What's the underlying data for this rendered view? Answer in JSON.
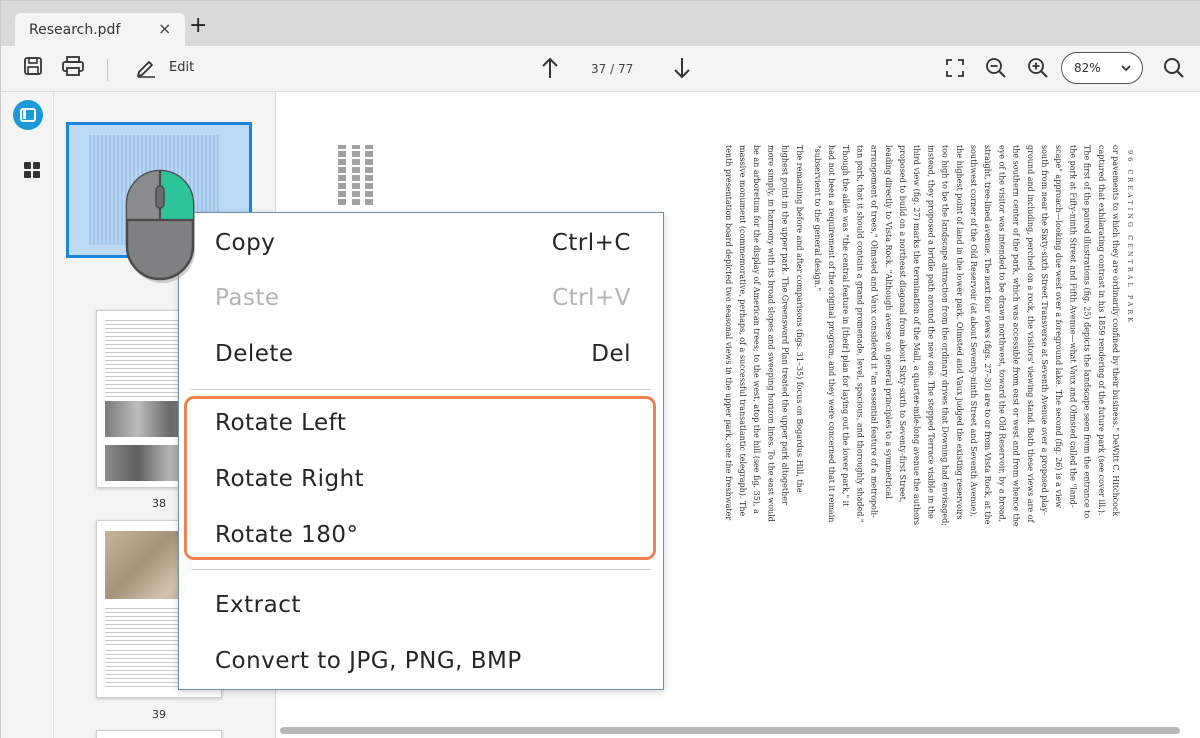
{
  "tab": {
    "title": "Research.pdf",
    "close": "×",
    "new": "+"
  },
  "toolbar": {
    "edit_label": "Edit",
    "page_indicator": "37 / 77",
    "zoom_value": "82%"
  },
  "thumbnails": {
    "page_numbers": [
      "38",
      "39"
    ]
  },
  "document": {
    "running_header": "96   CREATING CENTRAL PARK",
    "column_lines": [
      "or pavements to which they are ordinarily confined by their business.\" DeWitt C. Hitchcock",
      "captured that exhilarating contrast in his 1859 rendering of the future park (see cover ill.).",
      "The first of the paired illustrations (fig. 25) depicts the landscape seen from the entrance to",
      "the park at Fifty-ninth Street and Fifth Avenue—what Vaux and Olmsted called the \"land-",
      "scape\" approach—looking due west over a foreground lake. The second (fig. 26) is a view",
      "south from near the Sixty-sixth Street Transverse at Seventh Avenue over a proposed play-",
      "ground and including, perched on a rock, the visitors' viewing stand. Both these views are of",
      "the southern center of the park, which was accessible from east or west and from whence the",
      "eye of the visitor was intended to be drawn northwest, toward the Old Reservoir, by a broad,",
      "straight, tree-lined avenue. The next four views (figs. 27–30) are to or from Vista Rock, at the",
      "southwest corner of the Old Reservoir (at about Seventy-ninth Street and Seventh Avenue),",
      "the highest point of land in the lower park. Olmsted and Vaux judged the existing reservoirs",
      "too high to be the landscape attraction from the ordinary drives that Downing had envisaged;",
      "instead, they proposed a bridle path around the new one. The stepped Terrace visible in the",
      "third view (fig. 27) marks the termination of the Mall, a quarter-mile-long avenue the authors",
      "proposed to build on a northeast diagonal from about Sixty-sixth to Seventy-first Street,",
      "leading directly to Vista Rock. \"Although averse on general principles to a symmetrical",
      "arrangement of trees,\" Olmsted and Vaux considered it \"an essential feature of a metropoli-",
      "tan park, that it should contain a grand promenade, level, spacious, and thoroughly shaded.\"",
      "Though the allée was \"the central feature in [their] plan for laying out the lower park,\" it",
      "had not been a requirement of the original program, and they were concerned that it remain",
      "\"subservient to the general design.\"",
      "The remaining before and after comparisons (figs. 31–35) focus on Bogardus Hill, the",
      "highest point in the upper park. The Greensward Plan treated the upper park altogether",
      "more simply, in harmony with its broad slopes and sweeping horizon lines. To the east would",
      "be an arboretum for the display of American trees; to the west, atop the hill (see fig. 35), a",
      "massive monument (commemorative, perhaps, of a successful transatlantic telegraph). The",
      "tenth presentation board depicted two seasonal views in the upper park, one the freshwater"
    ]
  },
  "context_menu": {
    "items": [
      {
        "label": "Copy",
        "shortcut": "Ctrl+C"
      },
      {
        "label": "Paste",
        "shortcut": "Ctrl+V"
      },
      {
        "label": "Delete",
        "shortcut": "Del"
      },
      {
        "label": "Rotate Left",
        "shortcut": ""
      },
      {
        "label": "Rotate Right",
        "shortcut": ""
      },
      {
        "label": "Rotate 180°",
        "shortcut": ""
      },
      {
        "label": "Extract",
        "shortcut": ""
      },
      {
        "label": "Convert to JPG, PNG, BMP",
        "shortcut": ""
      }
    ]
  },
  "colors": {
    "accent": "#1a9bd7",
    "selection": "#1a86d9",
    "highlight_border": "#f08150",
    "mouse_button": "#2ec49a"
  }
}
